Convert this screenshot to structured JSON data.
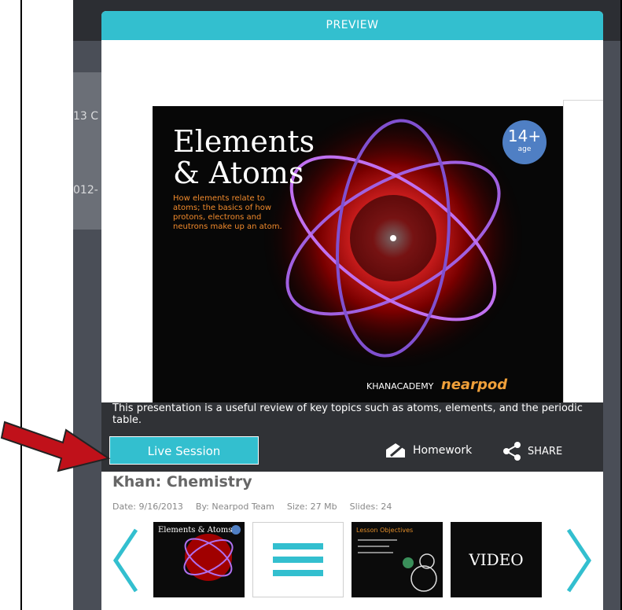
{
  "background": {
    "behind_text_1": "13 C",
    "behind_text_2": "012-"
  },
  "modal": {
    "header_title": "PREVIEW",
    "slide": {
      "title_line1": "Elements",
      "title_line2": "& Atoms",
      "description": "How elements relate to atoms; the basics of how protons, electrons and neutrons make up an atom.",
      "age_number": "14+",
      "age_label": "age",
      "logo_khan": "KHANACADEMY",
      "logo_nearpod": "nearpod"
    },
    "description": "This presentation is a useful review of key topics such as atoms, elements, and the periodic table.",
    "live_session_label": "Live Session",
    "homework_label": "Homework",
    "share_label": "SHARE",
    "lesson_title": "Khan: Chemistry",
    "meta": {
      "date": "Date: 9/16/2013",
      "by": "By: Nearpod Team",
      "size": "Size: 27 Mb",
      "slides": "Slides: 24"
    },
    "thumbnails": {
      "thumb1_title": "Elements & Atoms",
      "thumb3_title": "Lesson Objectives",
      "thumb4_label": "VIDEO"
    }
  },
  "colors": {
    "accent": "#33bfcf",
    "annotation_arrow": "#c0111a"
  }
}
